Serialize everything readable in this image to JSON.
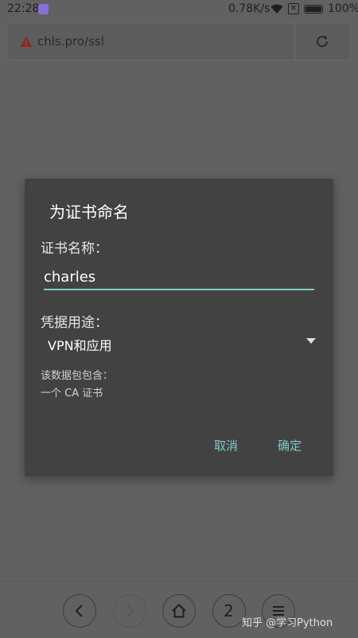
{
  "status_bar": {
    "time": "22:28",
    "network_speed": "0.78K/s",
    "sim_icon": "✕",
    "battery": "100%",
    "icons": [
      "app-notification-icon",
      "wifi-icon",
      "sim-icon",
      "battery-icon"
    ]
  },
  "browser": {
    "url": "chls.pro/ssl",
    "security_icon": "warning-icon",
    "reload_icon": "reload-icon"
  },
  "dialog": {
    "title": "为证书命名",
    "name_label": "证书名称：",
    "name_value": "charles",
    "usage_label": "凭据用途：",
    "usage_selected": "VPN和应用",
    "contains_line1": "该数据包包含：",
    "contains_line2": "一个 CA 证书",
    "cancel_label": "取消",
    "ok_label": "确定"
  },
  "bottom_nav": {
    "tab_count": "2",
    "items": [
      "back-icon",
      "forward-icon",
      "home-icon",
      "tabs-button",
      "menu-icon"
    ]
  },
  "watermark": "知乎 @学习Python",
  "colors": {
    "accent": "#80cbc4",
    "dialog_bg": "#424242",
    "scrim": "#616161"
  }
}
